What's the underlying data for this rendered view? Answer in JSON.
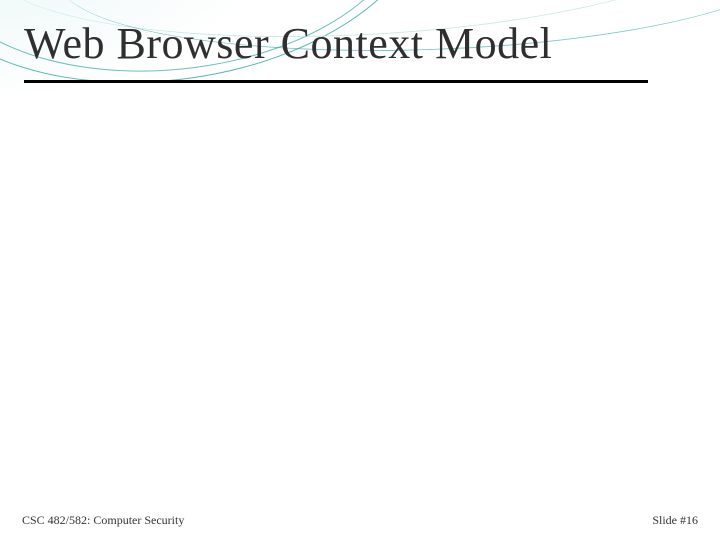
{
  "slide": {
    "title": "Web Browser Context Model",
    "footer": {
      "course": "CSC 482/582: Computer Security",
      "slide_number": "Slide #16"
    }
  }
}
